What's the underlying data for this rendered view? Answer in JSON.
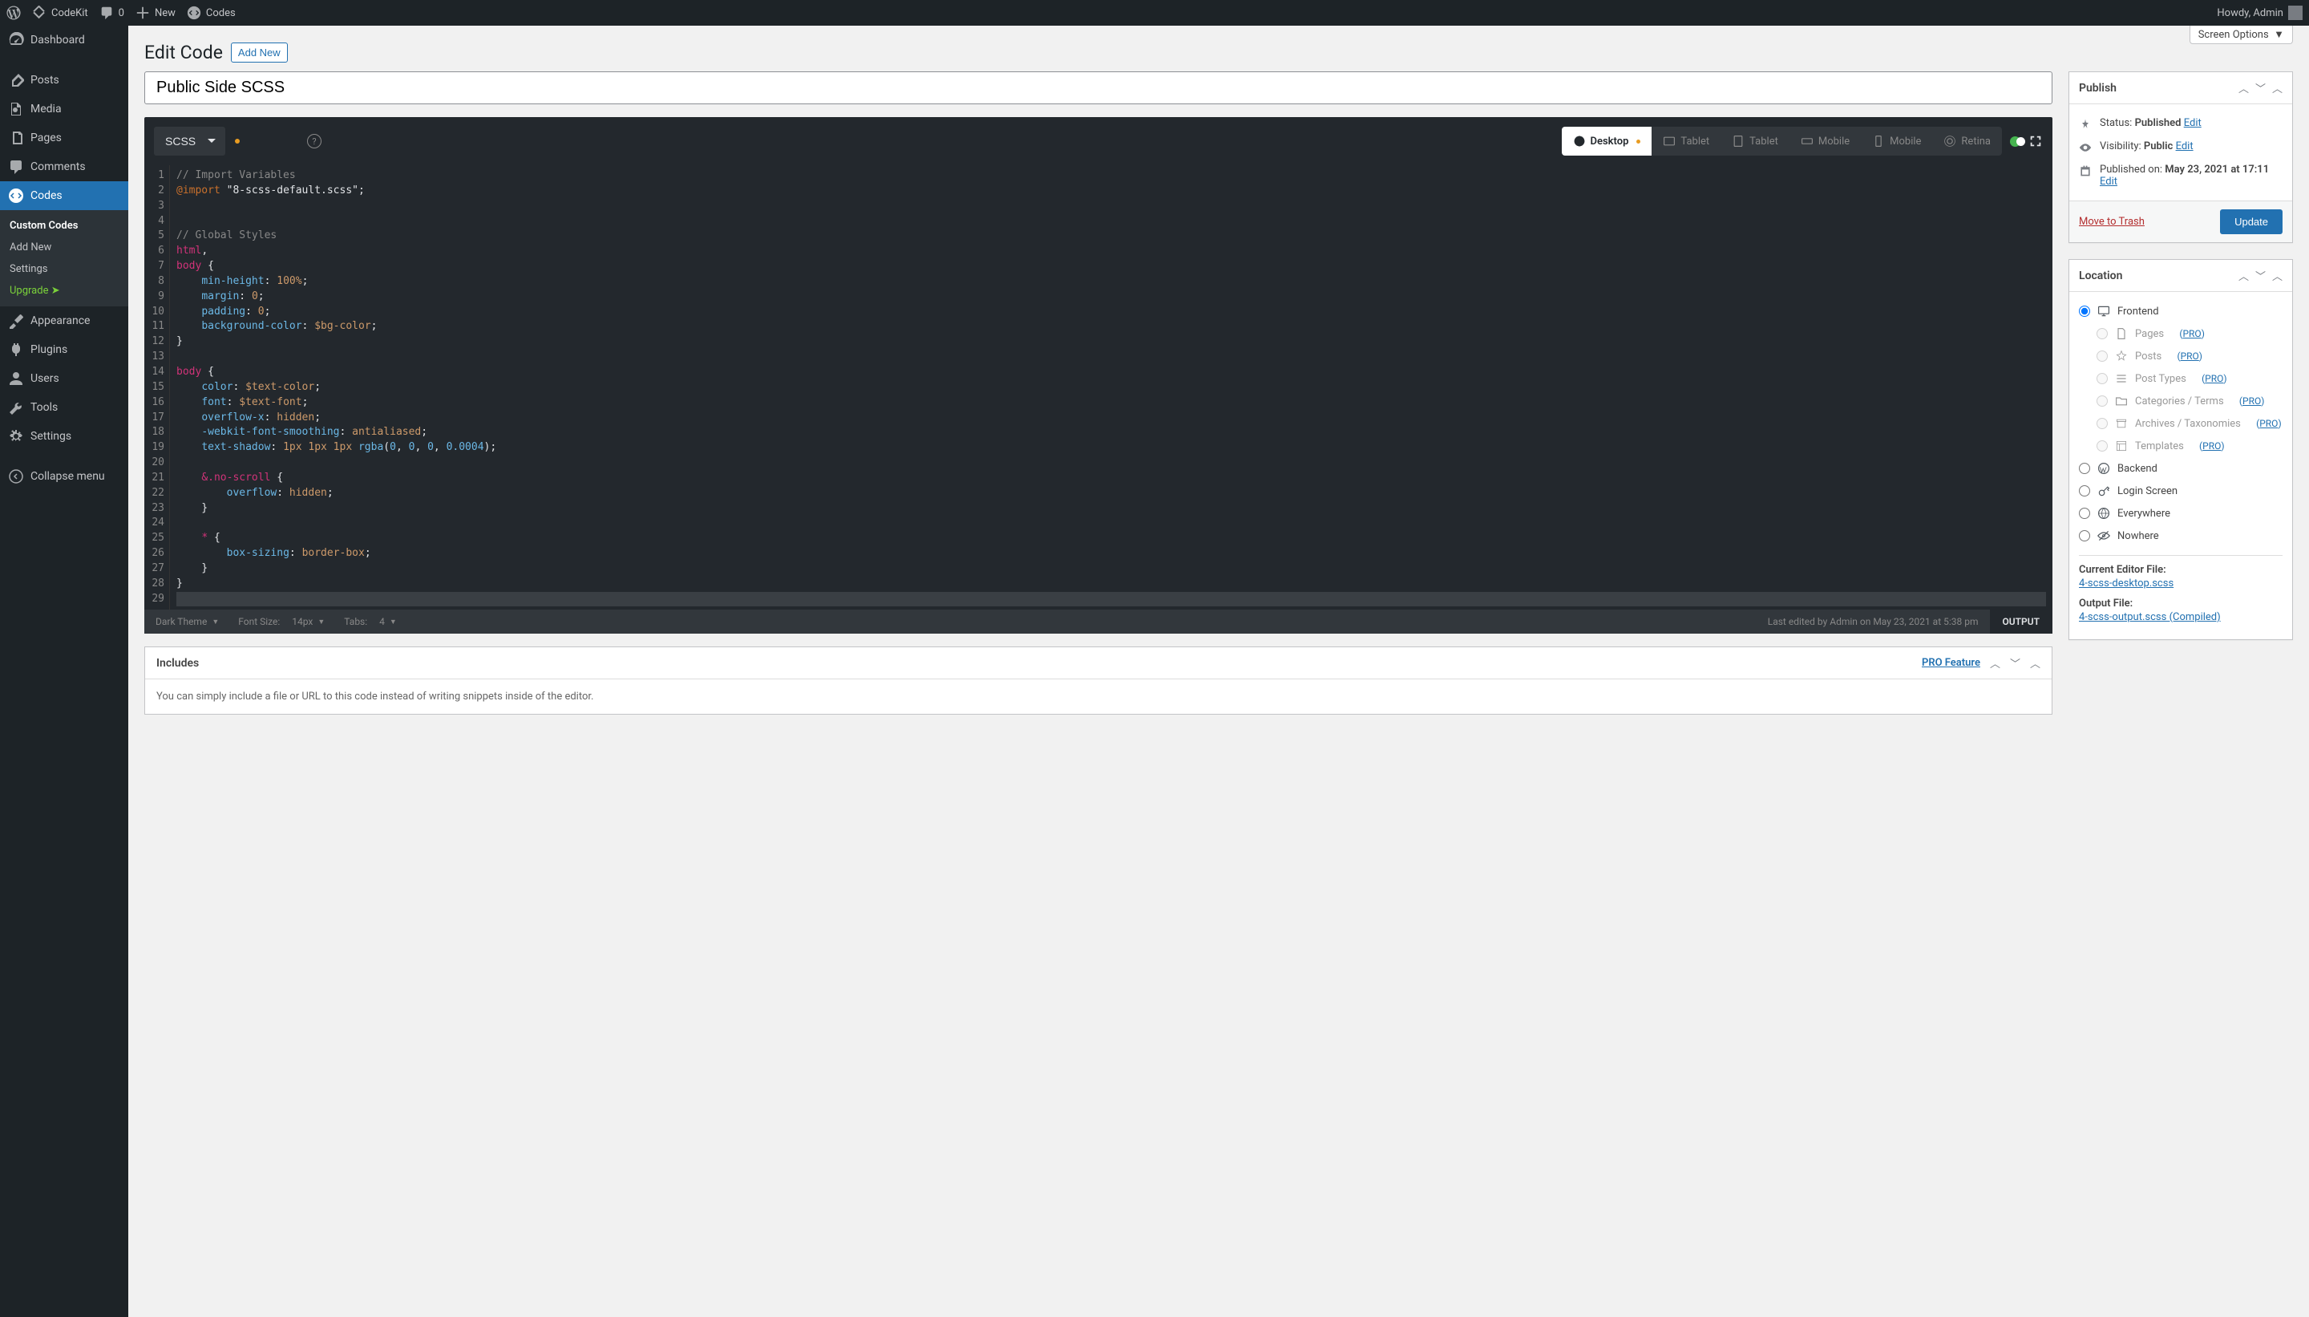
{
  "adminbar": {
    "site": "CodeKit",
    "comments": "0",
    "new": "New",
    "codes": "Codes",
    "howdy": "Howdy, Admin"
  },
  "sidebar": {
    "items": [
      {
        "label": "Dashboard"
      },
      {
        "label": "Posts"
      },
      {
        "label": "Media"
      },
      {
        "label": "Pages"
      },
      {
        "label": "Comments"
      },
      {
        "label": "Codes"
      },
      {
        "label": "Appearance"
      },
      {
        "label": "Plugins"
      },
      {
        "label": "Users"
      },
      {
        "label": "Tools"
      },
      {
        "label": "Settings"
      },
      {
        "label": "Collapse menu"
      }
    ],
    "subitems": [
      {
        "label": "Custom Codes"
      },
      {
        "label": "Add New"
      },
      {
        "label": "Settings"
      },
      {
        "label": "Upgrade  ➤"
      }
    ]
  },
  "screen_options": "Screen Options",
  "page": {
    "title": "Edit Code",
    "add_new": "Add New",
    "input_value": "Public Side SCSS"
  },
  "editor": {
    "language": "SCSS",
    "devices": [
      "Desktop",
      "Tablet",
      "Tablet",
      "Mobile",
      "Mobile",
      "Retina"
    ],
    "theme_label": "Dark Theme",
    "fontsize_label": "Font Size:",
    "fontsize_val": "14px",
    "tabs_label": "Tabs:",
    "tabs_val": "4",
    "last_edited": "Last edited by Admin on May 23, 2021 at 5:38 pm",
    "output": "OUTPUT"
  },
  "includes": {
    "title": "Includes",
    "pro": "PRO Feature",
    "body": "You can simply include a file or URL to this code instead of writing snippets inside of the editor."
  },
  "publish": {
    "title": "Publish",
    "status_label": "Status:",
    "status_value": "Published",
    "edit": "Edit",
    "visibility_label": "Visibility:",
    "visibility_value": "Public",
    "published_label": "Published on:",
    "published_value": "May 23, 2021 at 17:11",
    "trash": "Move to Trash",
    "update": "Update"
  },
  "location": {
    "title": "Location",
    "frontend": "Frontend",
    "pages": "Pages",
    "posts": "Posts",
    "post_types": "Post Types",
    "categories": "Categories / Terms",
    "archives": "Archives / Taxonomies",
    "templates": "Templates",
    "pro": "PRO",
    "backend": "Backend",
    "login": "Login Screen",
    "everywhere": "Everywhere",
    "nowhere": "Nowhere",
    "current_label": "Current Editor File:",
    "current_file": "4-scss-desktop.scss",
    "output_label": "Output File:",
    "output_file": "4-scss-output.scss (Compiled)"
  }
}
